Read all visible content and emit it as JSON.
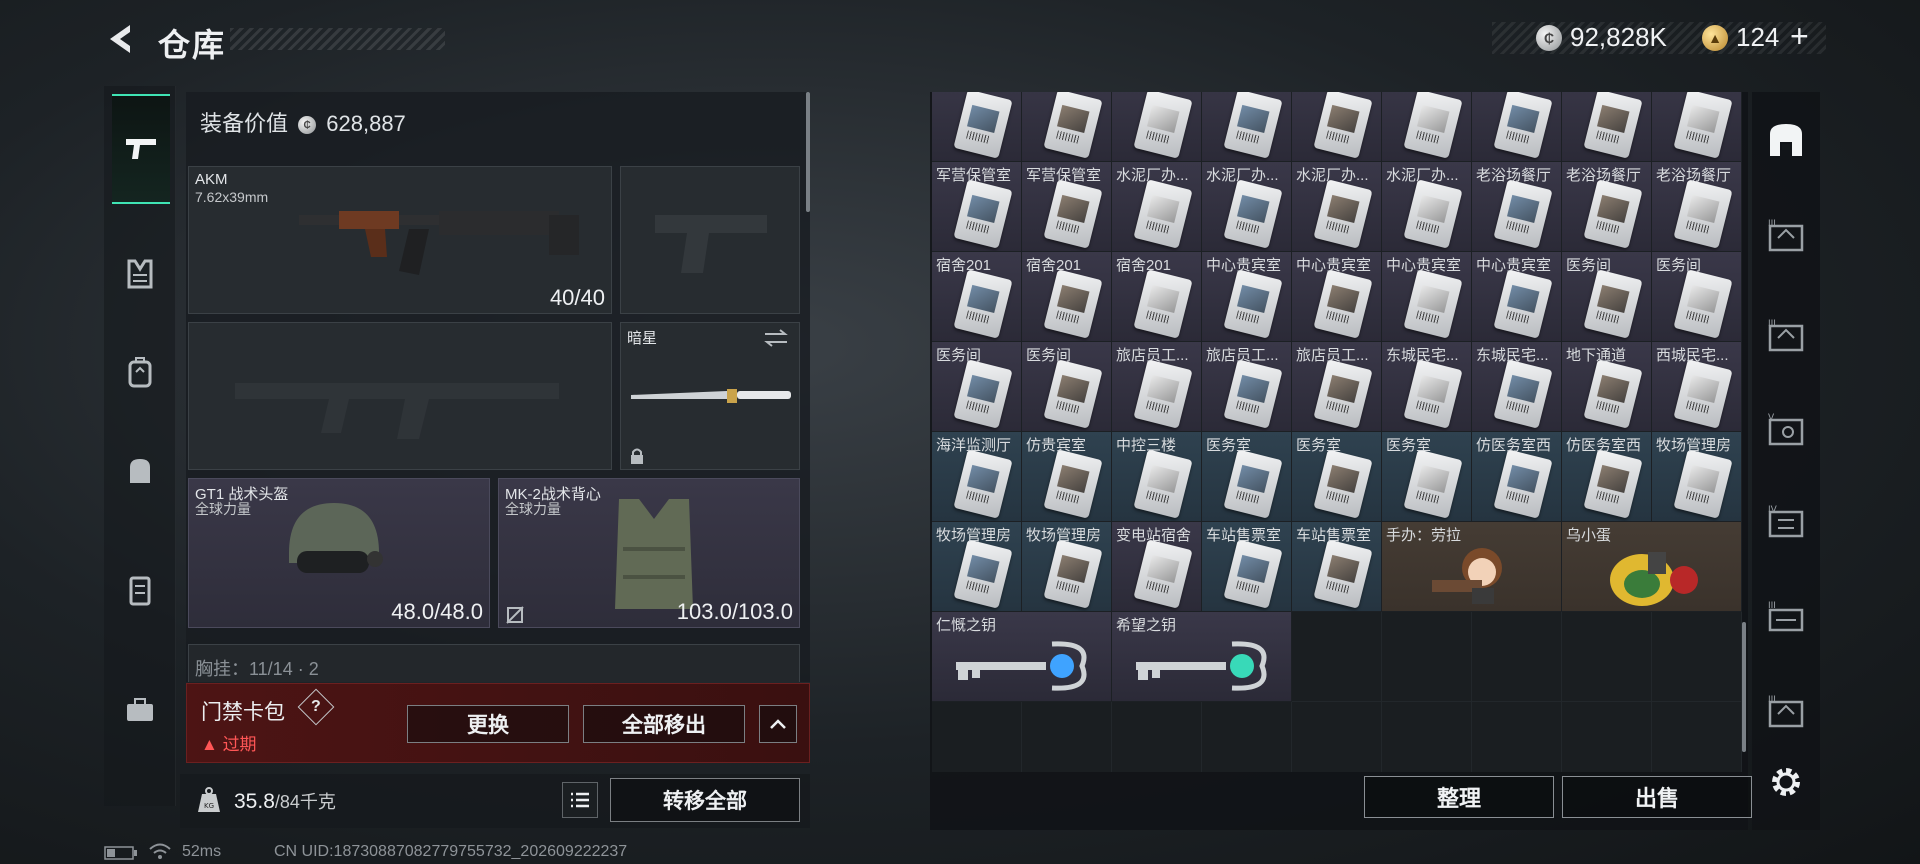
{
  "header": {
    "title": "仓库",
    "currency_silver": "92,828K",
    "currency_gold": "124"
  },
  "left_nav": [
    "weapon-icon",
    "armor-icon",
    "backpack-icon",
    "bag-icon",
    "chest-rig-icon",
    "briefcase-icon"
  ],
  "equipment": {
    "value_label": "装备价值",
    "value": "628,887",
    "primary": {
      "name": "AKM",
      "caliber": "7.62x39mm",
      "durability": "40/40"
    },
    "melee": {
      "name": "暗星"
    },
    "helmet": {
      "name": "GT1 战术头盔",
      "maker": "全球力量",
      "durability": "48.0/48.0"
    },
    "vest": {
      "name": "MK-2战术背心",
      "maker": "全球力量",
      "durability": "103.0/103.0"
    },
    "chest_peek": "胸挂：11/14 · 2"
  },
  "card_bag": {
    "name": "门禁卡包",
    "help": "?",
    "status": "过期",
    "replace": "更换",
    "remove_all": "全部移出"
  },
  "weight": {
    "current": "35.8",
    "max": "/84千克"
  },
  "transfer_all": "转移全部",
  "status_bar": {
    "ping": "52ms",
    "uid": "CN UID:187308870827797557​32_202609222237"
  },
  "grid": {
    "rows": [
      [
        "",
        "",
        "",
        "",
        "",
        "",
        "",
        "",
        ""
      ],
      [
        "军营保管室",
        "军营保管室",
        "水泥厂办...",
        "水泥厂办...",
        "水泥厂办...",
        "水泥厂办...",
        "老浴场餐厅",
        "老浴场餐厅",
        "老浴场餐厅"
      ],
      [
        "宿舍201",
        "宿舍201",
        "宿舍201",
        "中心贵宾室",
        "中心贵宾室",
        "中心贵宾室",
        "中心贵宾室",
        "医务间",
        "医务间"
      ],
      [
        "医务间",
        "医务间",
        "旅店员工...",
        "旅店员工...",
        "旅店员工...",
        "东城民宅...",
        "东城民宅...",
        "地下通道",
        "西城民宅..."
      ],
      [
        "海洋监测厅",
        "仿贵宾室",
        "中控三楼",
        "医务室",
        "医务室",
        "医务室",
        "仿医务室西",
        "仿医务室西",
        "牧场管理房"
      ],
      [
        "牧场管理房",
        "牧场管理房",
        "变电站宿舍",
        "车站售票室",
        "车站售票室",
        "手办：劳拉",
        "",
        "乌小蛋",
        ""
      ],
      [
        "仁慨之钥",
        "",
        "希望之钥",
        "",
        "",
        "",
        "",
        "",
        ""
      ]
    ]
  },
  "actions": {
    "sort": "整理",
    "sell": "出售"
  }
}
